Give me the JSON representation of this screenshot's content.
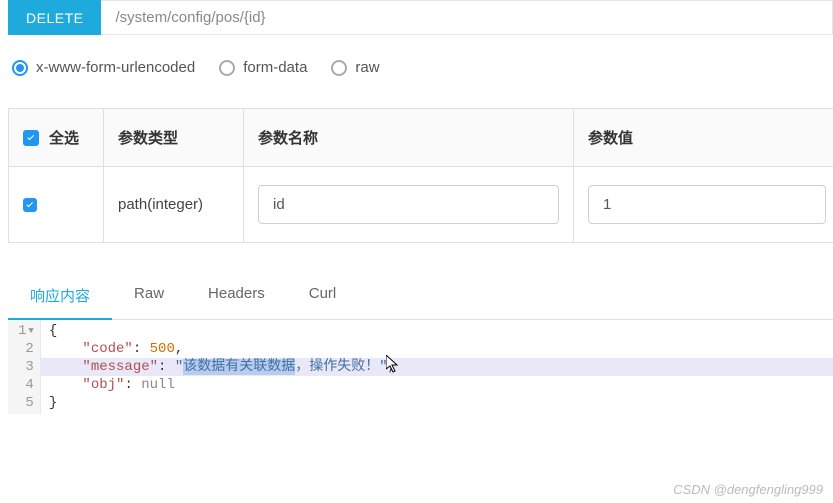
{
  "request": {
    "method": "DELETE",
    "url": "/system/config/pos/{id}"
  },
  "bodyTypes": {
    "options": [
      "x-www-form-urlencoded",
      "form-data",
      "raw"
    ],
    "selected": "x-www-form-urlencoded"
  },
  "paramsTable": {
    "headers": {
      "selectAll": "全选",
      "type": "参数类型",
      "name": "参数名称",
      "value": "参数值"
    },
    "rows": [
      {
        "checked": true,
        "type": "path(integer)",
        "name": "id",
        "value": "1"
      }
    ]
  },
  "responseTabs": {
    "items": [
      "响应内容",
      "Raw",
      "Headers",
      "Curl"
    ],
    "active": "响应内容"
  },
  "response": {
    "code": 500,
    "message": "该数据有关联数据，操作失败！",
    "obj": null
  },
  "responseLines": [
    {
      "n": 1,
      "fold": true,
      "text_parts": [
        {
          "t": "{",
          "c": "punc"
        }
      ]
    },
    {
      "n": 2,
      "text_parts": [
        {
          "t": "    ",
          "c": ""
        },
        {
          "t": "\"code\"",
          "c": "key"
        },
        {
          "t": ": ",
          "c": "punc"
        },
        {
          "t": "500",
          "c": "num"
        },
        {
          "t": ",",
          "c": "punc"
        }
      ]
    },
    {
      "n": 3,
      "hl": true,
      "text_parts": [
        {
          "t": "    ",
          "c": ""
        },
        {
          "t": "\"message\"",
          "c": "key"
        },
        {
          "t": ": ",
          "c": "punc"
        },
        {
          "t": "\"",
          "c": "str"
        },
        {
          "t": "该数据有关联数据",
          "c": "str sel"
        },
        {
          "t": "，操作失败！\"",
          "c": "str"
        },
        {
          "t": ",",
          "c": "punc"
        }
      ]
    },
    {
      "n": 4,
      "text_parts": [
        {
          "t": "    ",
          "c": ""
        },
        {
          "t": "\"obj\"",
          "c": "key"
        },
        {
          "t": ": ",
          "c": "punc"
        },
        {
          "t": "null",
          "c": "null"
        }
      ]
    },
    {
      "n": 5,
      "text_parts": [
        {
          "t": "}",
          "c": "punc"
        }
      ]
    }
  ],
  "watermark": "CSDN @dengfengling999"
}
